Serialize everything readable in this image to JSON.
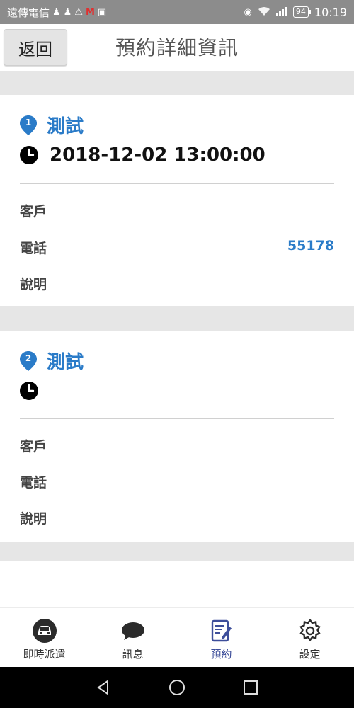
{
  "status_bar": {
    "carrier": "遠傳電信",
    "battery": "94",
    "time": "10:19"
  },
  "header": {
    "back_label": "返回",
    "title": "預約詳細資訊"
  },
  "reservations": [
    {
      "index": "1",
      "title": "測試",
      "datetime": "2018-12-02 13:00:00",
      "customer_label": "客戶",
      "customer_value": "",
      "phone_label": "電話",
      "phone_value": "55178",
      "note_label": "說明",
      "note_value": ""
    },
    {
      "index": "2",
      "title": "測試",
      "datetime": "",
      "customer_label": "客戶",
      "customer_value": "",
      "phone_label": "電話",
      "phone_value": "",
      "note_label": "說明",
      "note_value": ""
    }
  ],
  "tabs": [
    {
      "label": "即時派遣",
      "icon": "car-icon"
    },
    {
      "label": "訊息",
      "icon": "chat-bubble-icon"
    },
    {
      "label": "預約",
      "icon": "edit-note-icon",
      "active": true
    },
    {
      "label": "設定",
      "icon": "gear-icon"
    }
  ],
  "colors": {
    "accent_blue": "#2a7bc8",
    "active_tab": "#3d4e9a",
    "status_bar": "#8c8c8c",
    "gap_gray": "#e6e6e6"
  }
}
